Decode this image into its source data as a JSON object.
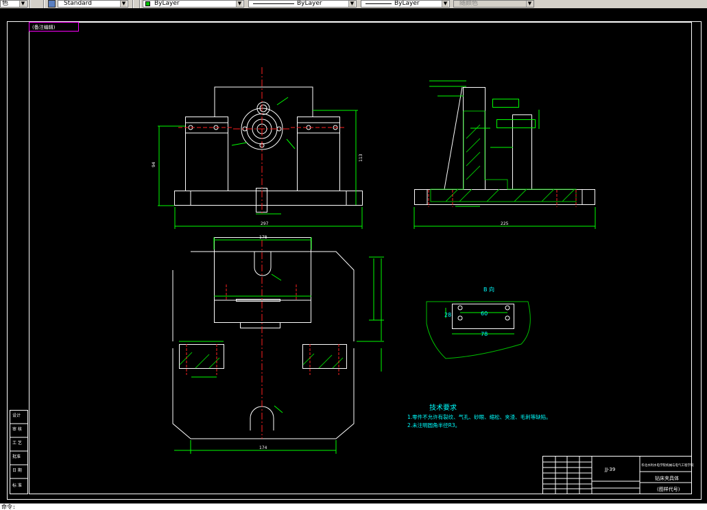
{
  "toolbar": {
    "textstyle_value": "Standard",
    "color_value": "ByLayer",
    "linetype_value": "ByLayer",
    "lineweight_value": "ByLayer",
    "plotstyle_value": "随颜色",
    "left_fragment": "色"
  },
  "drawing": {
    "corner_label": "(备注编辑)",
    "section_title": "B 向",
    "notes_title": "技术要求",
    "notes": [
      "1.零件不允许有裂纹、气孔、砂眼、缩松、夹渣、毛刺等缺陷。",
      "2.未注明圆角半径R3。"
    ],
    "title_block": {
      "school": "华北水利水电学院机械与电气工程学院",
      "drawing_number": "JJ-39",
      "part_name": "钻床夹具体",
      "code_label": "(图样代号)"
    },
    "side_labels": [
      "设计",
      "审 核",
      "工 艺",
      "批准",
      "日 期",
      "标 准"
    ],
    "dims": {
      "top_view_width": "297",
      "top_view_height_left": "94",
      "top_view_height_right": "113",
      "right_view_width": "225",
      "plan_width": "178",
      "plan_bottom_width": "174",
      "b_view_60": "60",
      "b_view_78": "78",
      "b_view_28": "28"
    }
  },
  "command": {
    "prompt": "命令:"
  },
  "colors": {
    "line_white": "#ffffff",
    "dim_green": "#00ff00",
    "center_red": "#ff2020",
    "text_cyan": "#00ffff",
    "hatch_green": "#00c000",
    "border_magenta": "#ff00ff"
  }
}
